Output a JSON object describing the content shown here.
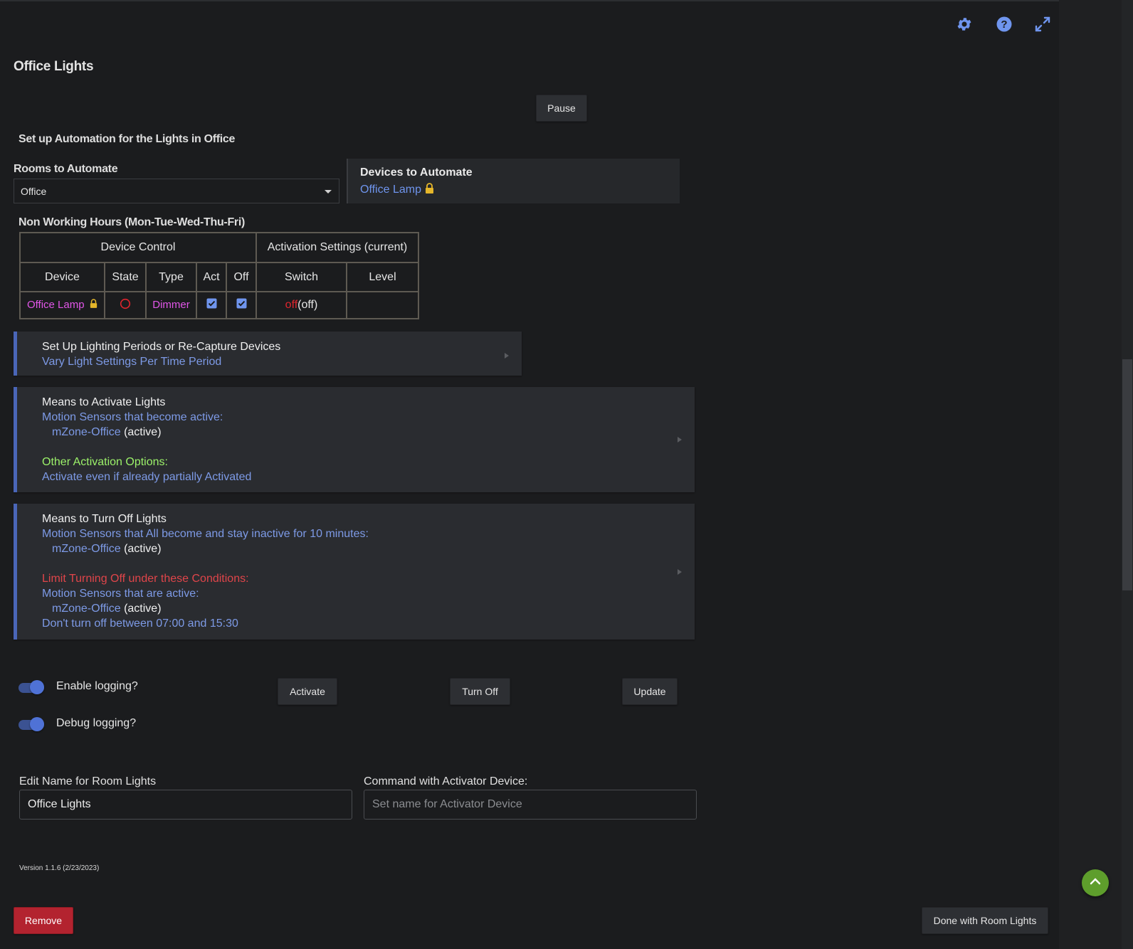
{
  "page": {
    "title": "Office Lights"
  },
  "toolbar": {
    "settings_icon": "gear-icon",
    "help_icon": "help-circle-icon",
    "fullscreen_icon": "expand-icon"
  },
  "pause_button": "Pause",
  "setup": {
    "heading": "Set up Automation for the Lights in Office"
  },
  "rooms": {
    "label": "Rooms to Automate",
    "selected": "Office"
  },
  "devices": {
    "heading": "Devices to Automate",
    "items": [
      "Office Lamp"
    ]
  },
  "schedule": {
    "heading": "Non Working Hours (Mon-Tue-Wed-Thu-Fri)",
    "group_headers": [
      "Device Control",
      "Activation Settings (current)"
    ],
    "columns": [
      "Device",
      "State",
      "Type",
      "Act",
      "Off",
      "Switch",
      "Level"
    ],
    "rows": [
      {
        "device": "Office Lamp",
        "state": "off-indicator",
        "type": "Dimmer",
        "act": true,
        "off": true,
        "switch_value": "off",
        "switch_current": "(off)",
        "level": ""
      }
    ]
  },
  "lighting_periods": {
    "title": "Set Up Lighting Periods or Re-Capture Devices",
    "subtitle": "Vary Light Settings Per Time Period"
  },
  "activate": {
    "title": "Means to Activate Lights",
    "motion_label": "Motion Sensors that become active:",
    "sensor": "mZone-Office",
    "sensor_state": "(active)",
    "other_label": "Other Activation Options:",
    "other_value": "Activate even if already partially Activated"
  },
  "turnoff": {
    "title": "Means to Turn Off Lights",
    "motion_label": "Motion Sensors that All become and stay inactive for 10 minutes:",
    "sensor": "mZone-Office",
    "sensor_state": "(active)",
    "limit_label": "Limit Turning Off under these Conditions:",
    "limit_motion_label": "Motion Sensors that are active:",
    "limit_sensor": "mZone-Office",
    "limit_sensor_state": "(active)",
    "time_limit": "Don't turn off between 07:00 and 15:30"
  },
  "logging": {
    "enable_label": "Enable logging?",
    "enable_on": true,
    "debug_label": "Debug logging?",
    "debug_on": true
  },
  "actions": {
    "activate": "Activate",
    "turn_off": "Turn Off",
    "update": "Update"
  },
  "name_field": {
    "label": "Edit Name for Room Lights",
    "value": "Office Lights"
  },
  "command_field": {
    "label": "Command with Activator Device:",
    "placeholder": "Set name for Activator Device"
  },
  "version": "Version 1.1.6 (2/23/2023)",
  "footer": {
    "remove": "Remove",
    "done": "Done with Room Lights"
  },
  "colors": {
    "accent_blue": "#7d9ae6",
    "link_blue": "#6f95ee",
    "magenta": "#e156e8",
    "remove_red": "#b3232f",
    "green_option": "#9cf26a",
    "limit_red": "#e0454a",
    "scroll_top_green": "#5e9e2c"
  }
}
